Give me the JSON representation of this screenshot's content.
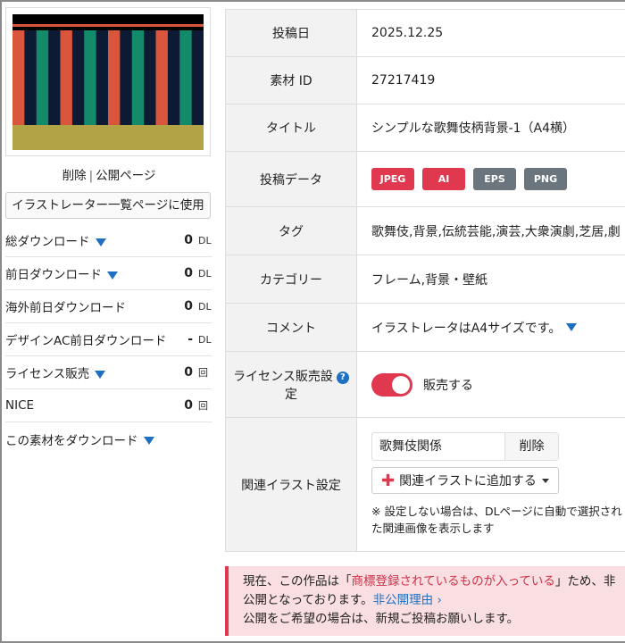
{
  "thumbnail": {
    "links": [
      "削除",
      "公開ページ"
    ]
  },
  "illustrator_button": "イラストレーター一覧ページに使用",
  "stats": [
    {
      "label": "総ダウンロード",
      "value": "0",
      "unit": "DL",
      "has_arrow": true
    },
    {
      "label": "前日ダウンロード",
      "value": "0",
      "unit": "DL",
      "has_arrow": true
    },
    {
      "label": "海外前日ダウンロード",
      "value": "0",
      "unit": "DL",
      "has_arrow": false
    },
    {
      "label": "デザインAC前日ダウンロード",
      "value": "-",
      "unit": "DL",
      "has_arrow": false
    },
    {
      "label": "ライセンス販売",
      "value": "0",
      "unit": "回",
      "has_arrow": true
    },
    {
      "label": "NICE",
      "value": "0",
      "unit": "回",
      "has_arrow": false
    },
    {
      "label": "この素材をダウンロード",
      "value": "",
      "unit": "",
      "has_arrow": true
    }
  ],
  "details": {
    "post_date_label": "投稿日",
    "post_date": "2025.12.25",
    "id_label": "素材 ID",
    "id": "27217419",
    "title_label": "タイトル",
    "title": "シンプルな歌舞伎柄背景-1（A4横）",
    "data_label": "投稿データ",
    "formats": [
      {
        "label": "JPEG",
        "color": "#e0384f"
      },
      {
        "label": "AI",
        "color": "#e0384f"
      },
      {
        "label": "EPS",
        "color": "#6b757d"
      },
      {
        "label": "PNG",
        "color": "#6b757d"
      }
    ],
    "tags_label": "タグ",
    "tags": "歌舞伎,背景,伝統芸能,演芸,大衆演劇,芝居,劇",
    "category_label": "カテゴリー",
    "category": "フレーム,背景・壁紙",
    "comment_label": "コメント",
    "comment": "イラストレータはA4サイズです。",
    "license_label_1": "ライセンス販売設",
    "license_label_2": "定",
    "license_help": "?",
    "license_toggle": "販売する",
    "related_label": "関連イラスト設定",
    "related_value": "歌舞伎関係",
    "related_delete": "削除",
    "related_add": "関連イラストに追加する",
    "related_note": "※ 設定しない場合は、DLページに自動で選択され",
    "related_note_2": "た関連画像を表示します"
  },
  "alert": {
    "line1_a": "現在、この作品は「",
    "line1_b": "商標登録されているものが入っている",
    "line1_c": "」ため、非",
    "line2_a": "公開となっております。",
    "line2_link": "非公開理由 ›",
    "line3": "公開をご希望の場合は、新規ご投稿お願いします。"
  },
  "colors": {
    "accent": "#e0384f",
    "link": "#1f6fc2",
    "stripe_red": "#d9553b",
    "stripe_green": "#138a6a",
    "stripe_navy": "#0d1a33",
    "ground": "#b3a347"
  }
}
